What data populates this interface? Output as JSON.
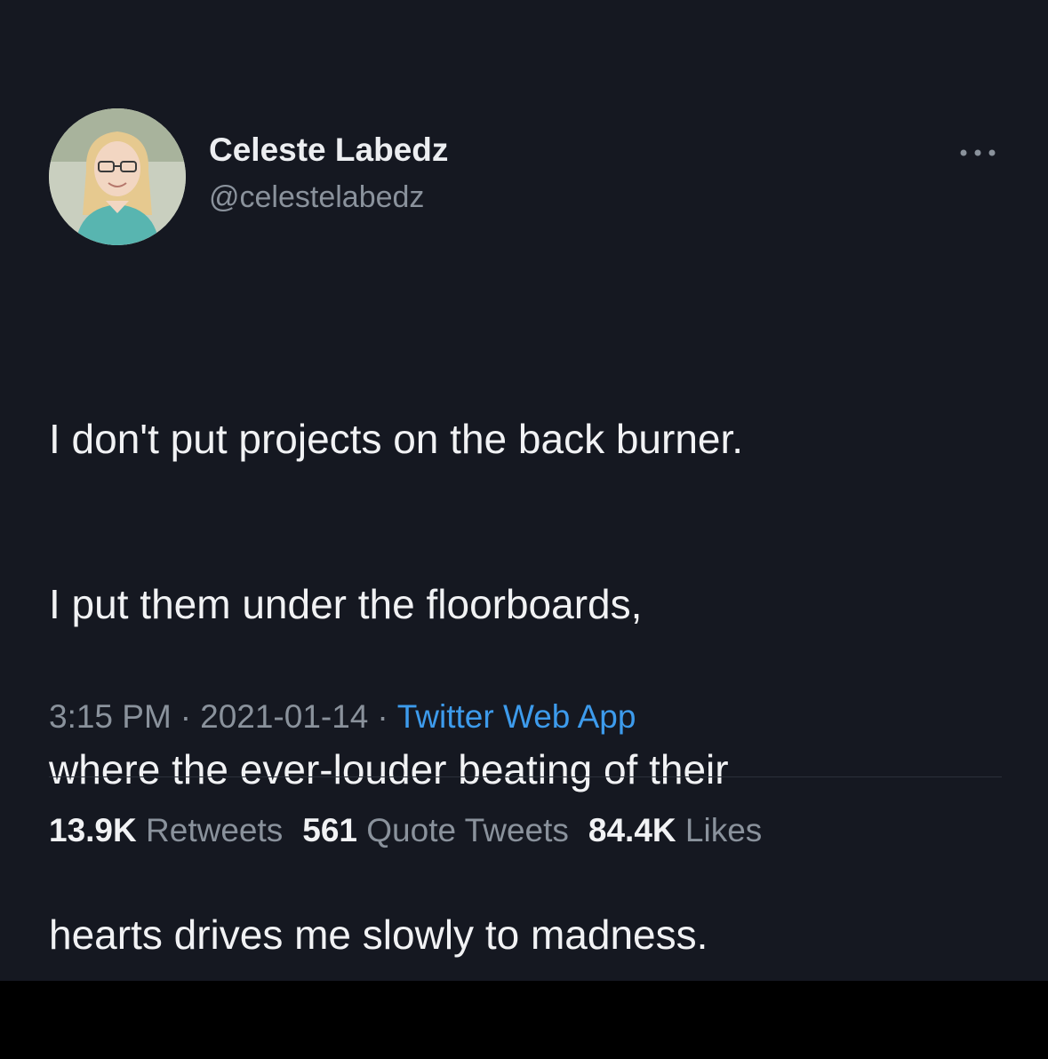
{
  "tweet": {
    "author": {
      "display_name": "Celeste Labedz",
      "handle": "@celestelabedz",
      "avatar_icon": "profile-photo"
    },
    "more_icon": "more-options-icon",
    "text_lines": [
      "I don't put projects on the back burner.",
      "I put them under the floorboards,",
      "where the ever-louder beating of their",
      "hearts drives me slowly to madness."
    ],
    "meta": {
      "time": "3:15 PM",
      "separator": "·",
      "date": "2021-01-14",
      "source": "Twitter Web App"
    },
    "stats": {
      "retweets_count": "13.9K",
      "retweets_label": "Retweets",
      "quotes_count": "561",
      "quotes_label": "Quote Tweets",
      "likes_count": "84.4K",
      "likes_label": "Likes"
    }
  },
  "colors": {
    "background": "#151821",
    "text_primary": "#f1f2f4",
    "text_secondary": "#8a929c",
    "link": "#3d9bec"
  }
}
